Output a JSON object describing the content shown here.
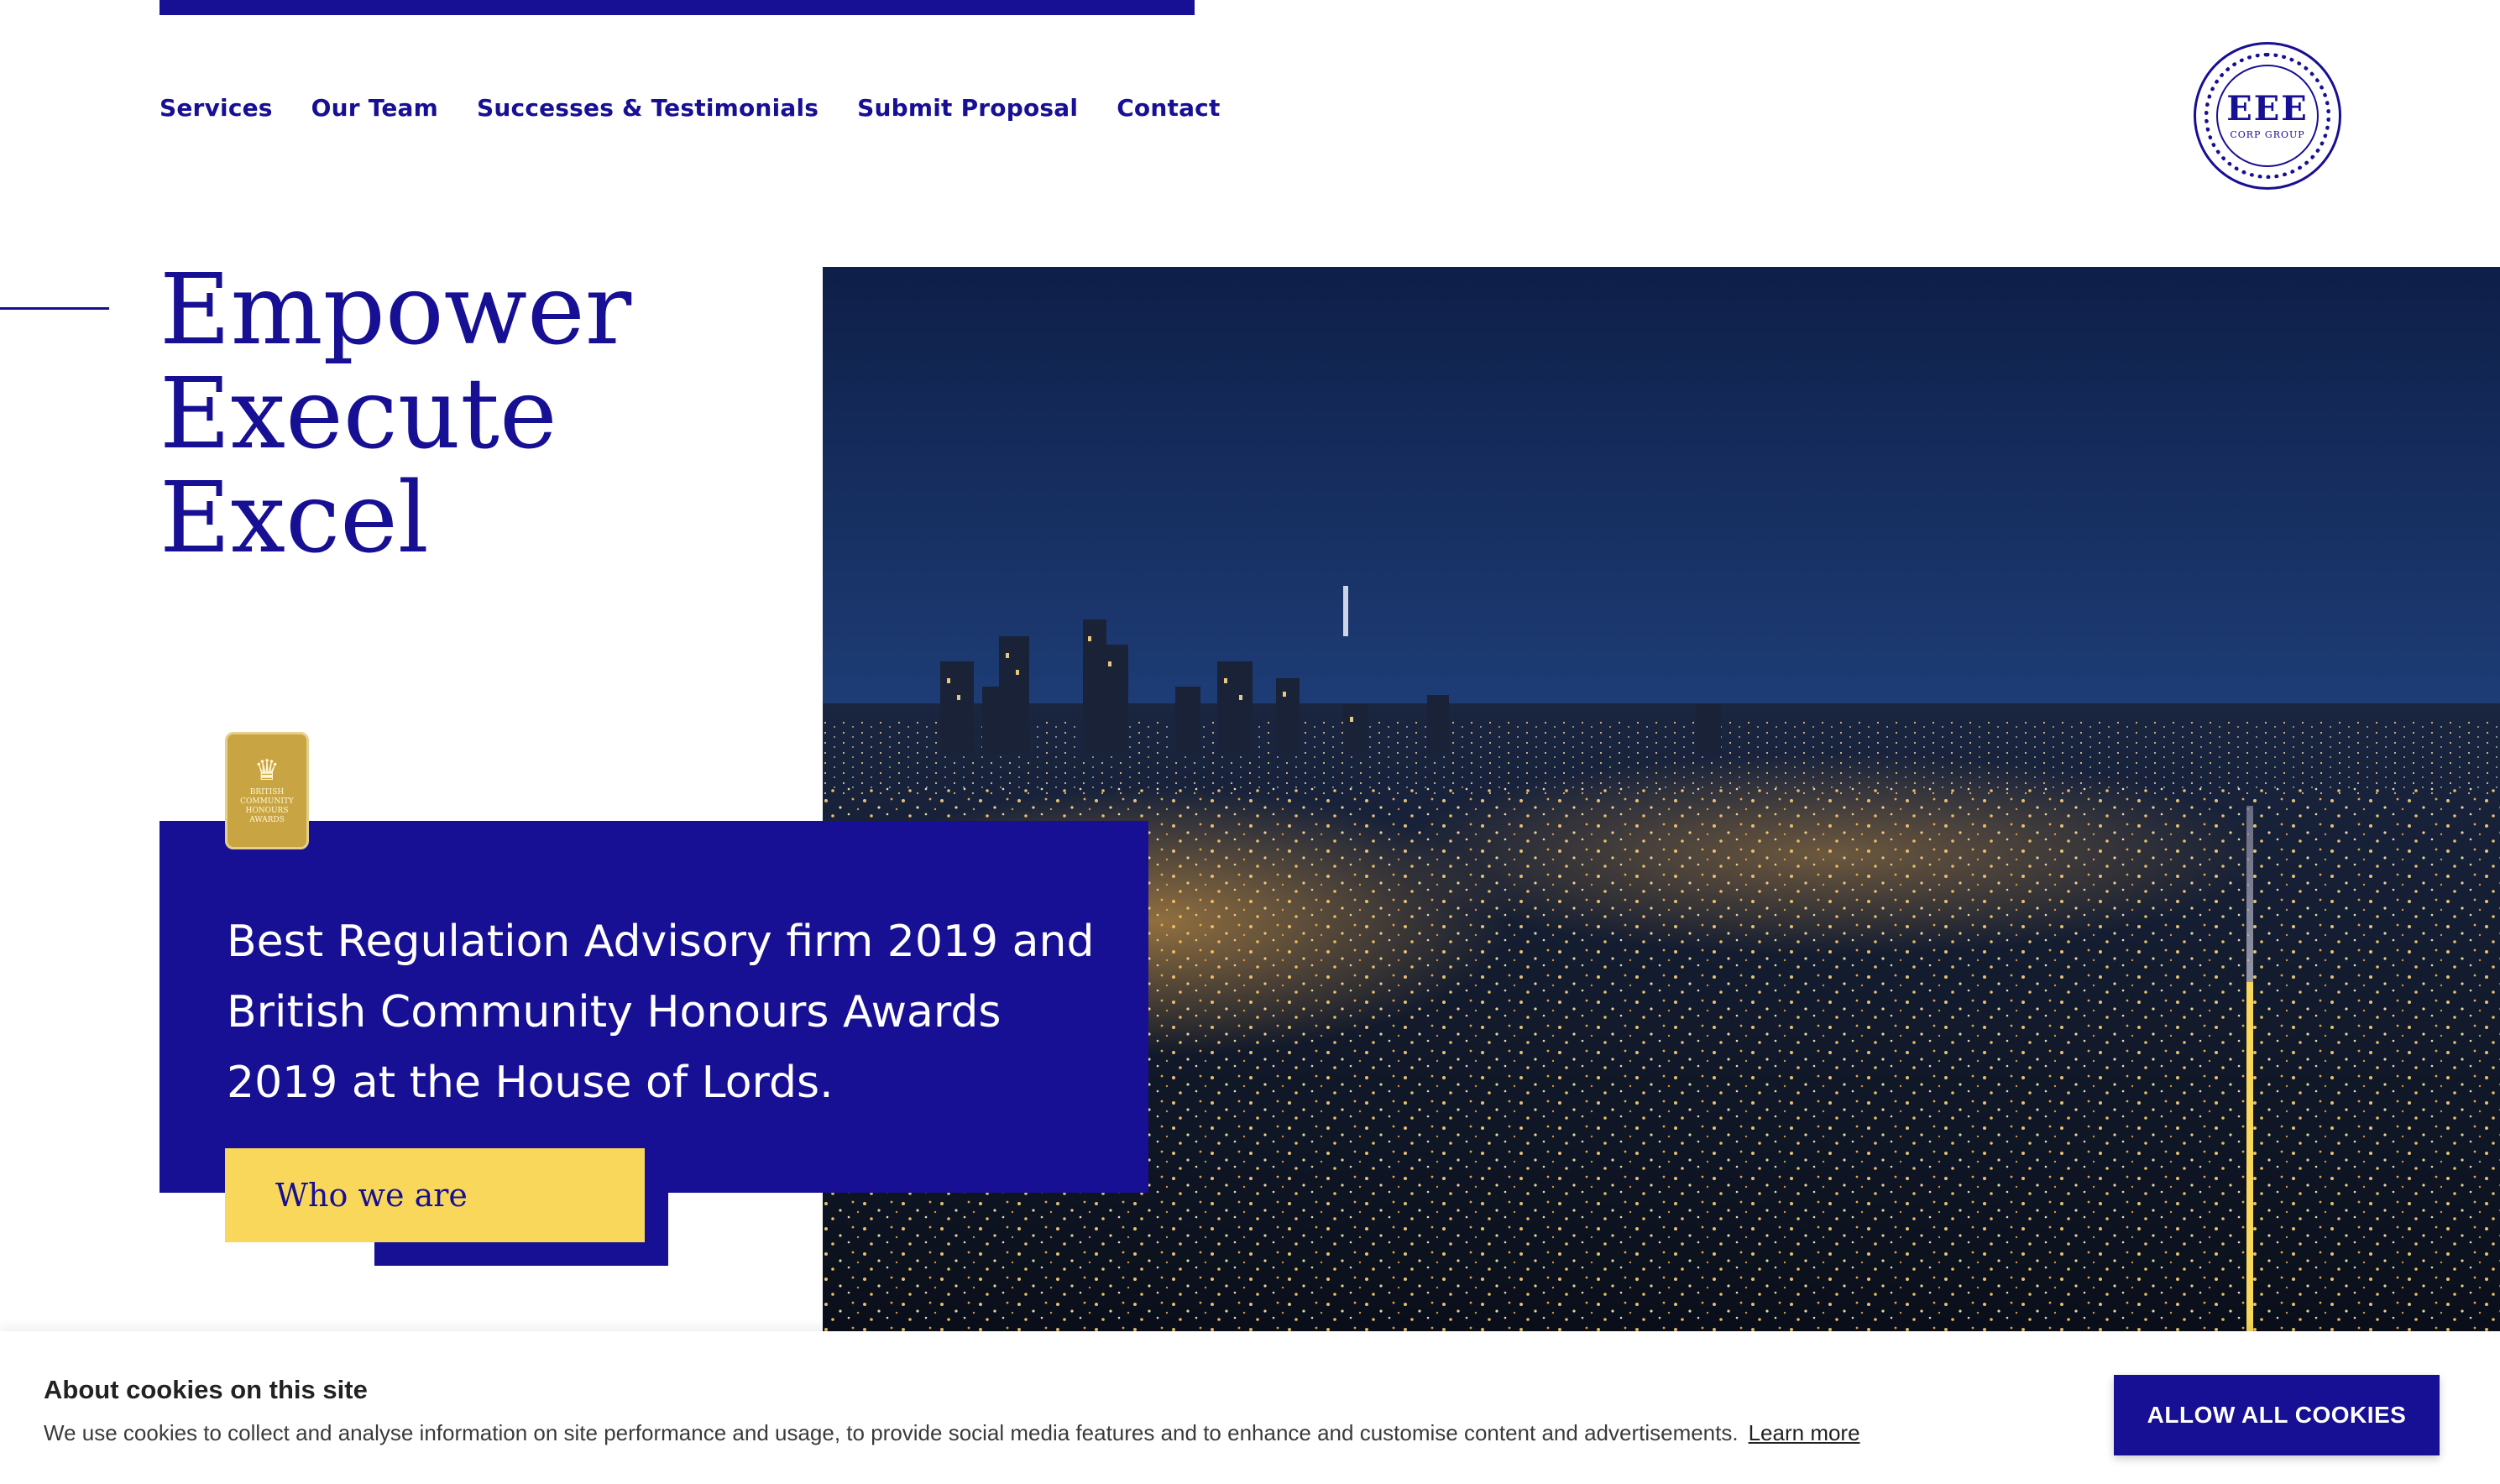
{
  "nav": {
    "items": [
      {
        "label": "Services"
      },
      {
        "label": "Our Team"
      },
      {
        "label": "Successes & Testimonials"
      },
      {
        "label": "Submit Proposal"
      },
      {
        "label": "Contact"
      }
    ]
  },
  "logo": {
    "mark": "EEE",
    "sub": "CORP GROUP",
    "icon": "company-seal-icon"
  },
  "hero": {
    "lines": [
      "Empower",
      "Execute",
      "Excel"
    ]
  },
  "award": {
    "badge_text": "British Community Honours Awards",
    "text": "Best Regulation Advisory firm 2019 and British Community Honours Awards 2019 at the House of Lords."
  },
  "cta": {
    "label": "Who we are"
  },
  "cookie": {
    "title": "About cookies on this site",
    "text": "We use cookies to collect and analyse information on site performance and usage, to provide social media features and to enhance and customise content and advertisements.",
    "learn_more": "Learn more",
    "button": "ALLOW ALL COOKIES"
  },
  "colors": {
    "brand": "#170f94",
    "accent": "#f8d75b",
    "badge": "#c8a542"
  }
}
